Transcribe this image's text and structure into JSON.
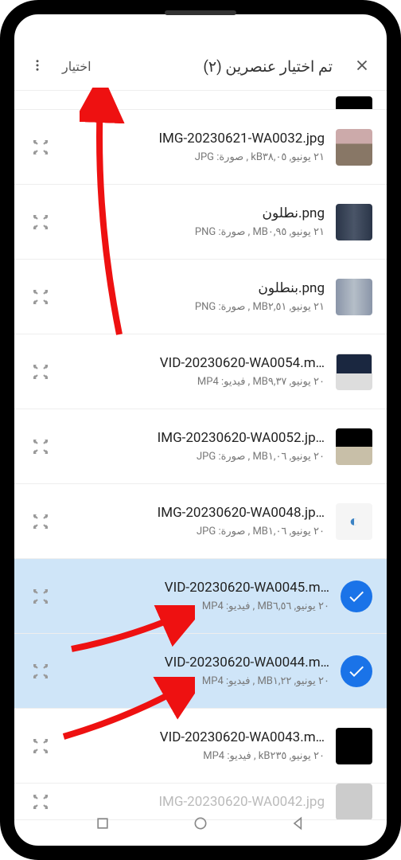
{
  "header": {
    "title": "تم اختيار عنصرين (٢)",
    "select_label": "اختيار"
  },
  "files": [
    {
      "name": "",
      "meta": "",
      "selected": false,
      "thumb": "th-black",
      "partial": "top"
    },
    {
      "name": "IMG-20230621-WA0032.jpg",
      "meta": "٢١ يونيو, kB٣٨,٠٥ , صورة: JPG",
      "selected": false,
      "thumb": "th-face"
    },
    {
      "name": "نطلون.png",
      "meta": "٢١ يونيو, MB٠,٩٥ , صورة: PNG",
      "selected": false,
      "thumb": "th-jeans1"
    },
    {
      "name": "بنطلون.png",
      "meta": "٢١ يونيو, MB٢,٥١ , صورة: PNG",
      "selected": false,
      "thumb": "th-jeans2"
    },
    {
      "name": "VID-20230620-WA0054.m…",
      "meta": "٢٠ يونيو, MB٩,٣٧ , فيديو: MP4",
      "selected": false,
      "thumb": "th-laptop"
    },
    {
      "name": "IMG-20230620-WA0052.jp…",
      "meta": "٢٠ يونيو, MB١,٠٦ , صورة: JPG",
      "selected": false,
      "thumb": "th-box"
    },
    {
      "name": "IMG-20230620-WA0048.jp…",
      "meta": "٢٠ يونيو, MB١,٠٦ , صورة: JPG",
      "selected": false,
      "thumb": "th-logo"
    },
    {
      "name": "VID-20230620-WA0045.m…",
      "meta": "٢٠ يونيو, MB٦,٥٦ , فيديو: MP4",
      "selected": true,
      "thumb": ""
    },
    {
      "name": "VID-20230620-WA0044.m…",
      "meta": "٢٠ يونيو, MB١,٢٢ , فيديو: MP4",
      "selected": true,
      "thumb": ""
    },
    {
      "name": "VID-20230620-WA0043.m…",
      "meta": "٢٠ يونيو, kB٢٣٥ , فيديو: MP4",
      "selected": false,
      "thumb": "th-black"
    },
    {
      "name": "IMG-20230620-WA0042.jpg",
      "meta": "",
      "selected": false,
      "thumb": "",
      "partial": "bottom"
    }
  ]
}
